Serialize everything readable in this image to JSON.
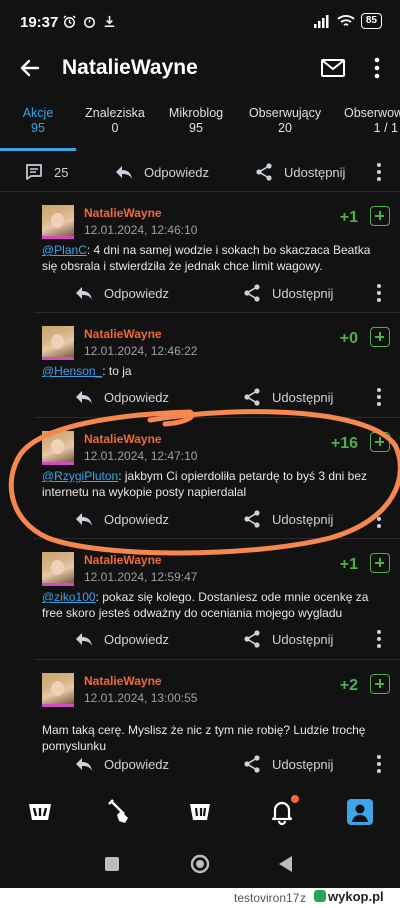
{
  "status_bar": {
    "time": "19:37",
    "battery": "85"
  },
  "app_bar": {
    "title": "NatalieWayne"
  },
  "tabs": [
    {
      "label": "Akcje",
      "count": "95",
      "active": true
    },
    {
      "label": "Znaleziska",
      "count": "0"
    },
    {
      "label": "Mikroblog",
      "count": "95"
    },
    {
      "label": "Obserwujący",
      "count": "20"
    },
    {
      "label": "Obserwow",
      "count": "1 / 1"
    }
  ],
  "top_actions": {
    "comments_count": "25",
    "reply_label": "Odpowiedz",
    "share_label": "Udostępnij"
  },
  "comments": [
    {
      "author": "NatalieWayne",
      "date": "12.01.2024, 12:46:10",
      "votes": "+1",
      "mention": "@PlanC",
      "text": ": 4 dni na samej wodzie i sokach bo skaczaca Beatka się obsrala i stwierdziła że jednak chce limit wagowy."
    },
    {
      "author": "NatalieWayne",
      "date": "12.01.2024, 12:46:22",
      "votes": "+0",
      "mention": "@Henson_",
      "text": ": to ja"
    },
    {
      "author": "NatalieWayne",
      "date": "12.01.2024, 12:47:10",
      "votes": "+16",
      "mention": "@RzygiPluton",
      "text": ": jakbym Ci opierdoliła petardę to byś 3 dni bez internetu na wykopie posty napierdalal"
    },
    {
      "author": "NatalieWayne",
      "date": "12.01.2024, 12:59:47",
      "votes": "+1",
      "mention": "@ziko100",
      "text": ": pokaz się kolego. Dostaniesz ode mnie ocenkę za free skoro jesteś odważny do oceniania mojego wygladu"
    },
    {
      "author": "NatalieWayne",
      "date": "12.01.2024, 13:00:55",
      "votes": "+2",
      "mention": "",
      "text": "Mam taką cerę. Myslisz że nic z tym nie robię? Ludzie trochę pomyslunku"
    }
  ],
  "comment_actions": {
    "reply_label": "Odpowiedz",
    "share_label": "Udostępnij"
  },
  "bottom_nav": [
    "home-icon",
    "shovel-icon",
    "mikroblog-icon",
    "bell-icon",
    "profile-icon"
  ],
  "footer": {
    "username": "testoviron17",
    "z": "z",
    "site": "wykop.pl"
  },
  "colors": {
    "accent": "#3ea4e8",
    "author": "#f06a38",
    "vote": "#4db04a",
    "annotation": "#f5874f"
  }
}
